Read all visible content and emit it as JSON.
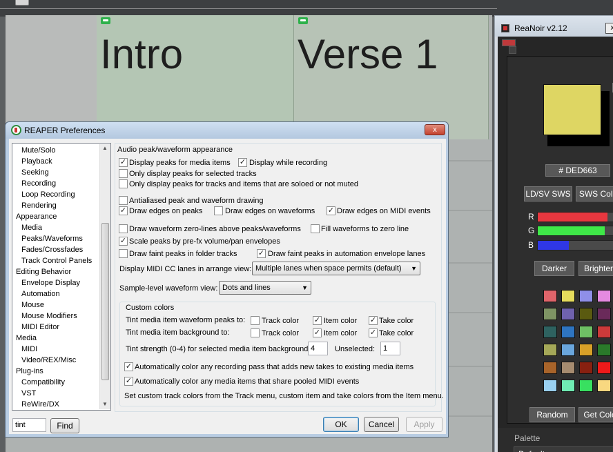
{
  "arrange": {
    "regions": [
      {
        "name": "Intro"
      },
      {
        "name": "Verse 1"
      }
    ]
  },
  "reanoir": {
    "title": "ReaNoir v2.12",
    "close_label": "x",
    "help_label": "?",
    "current_color": "#DED663",
    "hex_label": "# DED663",
    "buttons": {
      "ldsv": "LD/SV SWS",
      "sws_colors": "SWS Colors",
      "darker": "Darker",
      "brighter": "Brighter",
      "random": "Random",
      "get_color": "Get Color"
    },
    "sliders": [
      {
        "label": "R",
        "value": 222,
        "max": 255,
        "color": "#e8373f"
      },
      {
        "label": "G",
        "value": 214,
        "max": 255,
        "color": "#3fe848"
      },
      {
        "label": "B",
        "value": 99,
        "max": 255,
        "color": "#2f37e6"
      }
    ],
    "palette_grid": [
      [
        "#e0646a",
        "#e6dc5c",
        "#8f8fe8",
        "#e48ae0"
      ],
      [
        "#7e9464",
        "#6f62ae",
        "#5a5a10",
        "#6a2a5a"
      ],
      [
        "#2e6260",
        "#2e74c0",
        "#6ec064",
        "#cc3a3a"
      ],
      [
        "#a5a858",
        "#6aa6dc",
        "#d8a028",
        "#2a7a2a"
      ],
      [
        "#a8642a",
        "#a68c70",
        "#882010",
        "#ee1a1a"
      ],
      [
        "#9ad0f0",
        "#70ecb4",
        "#38e060",
        "#f8d880"
      ]
    ],
    "palette_section": {
      "label": "Palette",
      "selected": "Default"
    }
  },
  "prefs": {
    "title": "REAPER Preferences",
    "close_label": "x",
    "tree": [
      {
        "label": "Mute/Solo",
        "indent": 1
      },
      {
        "label": "Playback",
        "indent": 1
      },
      {
        "label": "Seeking",
        "indent": 1
      },
      {
        "label": "Recording",
        "indent": 1
      },
      {
        "label": "Loop Recording",
        "indent": 1
      },
      {
        "label": "Rendering",
        "indent": 1
      },
      {
        "label": "Appearance",
        "indent": 0
      },
      {
        "label": "Media",
        "indent": 1
      },
      {
        "label": "Peaks/Waveforms",
        "indent": 1
      },
      {
        "label": "Fades/Crossfades",
        "indent": 1
      },
      {
        "label": "Track Control Panels",
        "indent": 1
      },
      {
        "label": "Editing Behavior",
        "indent": 0
      },
      {
        "label": "Envelope Display",
        "indent": 1
      },
      {
        "label": "Automation",
        "indent": 1
      },
      {
        "label": "Mouse",
        "indent": 1
      },
      {
        "label": "Mouse Modifiers",
        "indent": 1
      },
      {
        "label": "MIDI Editor",
        "indent": 1
      },
      {
        "label": "Media",
        "indent": 0
      },
      {
        "label": "MIDI",
        "indent": 1
      },
      {
        "label": "Video/REX/Misc",
        "indent": 1
      },
      {
        "label": "Plug-ins",
        "indent": 0
      },
      {
        "label": "Compatibility",
        "indent": 1
      },
      {
        "label": "VST",
        "indent": 1
      },
      {
        "label": "ReWire/DX",
        "indent": 1
      }
    ],
    "search": {
      "value": "tint",
      "find_label": "Find"
    },
    "section_title": "Audio peak/waveform appearance",
    "options": {
      "display_peaks": {
        "label": "Display peaks for media items",
        "checked": true
      },
      "display_recording": {
        "label": "Display while recording",
        "checked": true
      },
      "only_selected": {
        "label": "Only display peaks for selected tracks",
        "checked": false
      },
      "only_soloed": {
        "label": "Only display peaks for tracks and items that are soloed or not muted",
        "checked": false
      },
      "antialiased": {
        "label": "Antialiased peak and waveform drawing",
        "checked": false
      },
      "edges_peaks": {
        "label": "Draw edges on peaks",
        "checked": true
      },
      "edges_waveforms": {
        "label": "Draw edges on waveforms",
        "checked": false
      },
      "edges_midi": {
        "label": "Draw edges on MIDI events",
        "checked": true
      },
      "zero_lines": {
        "label": "Draw waveform zero-lines above peaks/waveforms",
        "checked": false
      },
      "fill_zero": {
        "label": "Fill waveforms to zero line",
        "checked": false
      },
      "scale_peaks": {
        "label": "Scale peaks by pre-fx volume/pan envelopes",
        "checked": true
      },
      "faint_folder": {
        "label": "Draw faint peaks in folder tracks",
        "checked": false
      },
      "faint_automation": {
        "label": "Draw faint peaks in automation envelope lanes",
        "checked": true
      }
    },
    "midi_cc": {
      "label": "Display MIDI CC lanes in arrange view:",
      "value": "Multiple lanes when space permits (default)"
    },
    "sample_level": {
      "label": "Sample-level waveform view:",
      "value": "Dots and lines"
    },
    "custom_colors": {
      "title": "Custom colors",
      "peaks_label": "Tint media item waveform peaks to:",
      "background_label": "Tint media item background to:",
      "track_color": "Track color",
      "item_color": "Item color",
      "take_color": "Take color",
      "peaks_checks": {
        "track": false,
        "item": true,
        "take": true
      },
      "bg_checks": {
        "track": false,
        "item": true,
        "take": true
      },
      "strength_label": "Tint strength (0-4) for selected media item background:",
      "strength_value": "4",
      "unselected_label": "Unselected:",
      "unselected_value": "1",
      "auto_recording": {
        "label": "Automatically color any recording pass that adds new takes to existing media items",
        "checked": true
      },
      "auto_pooled": {
        "label": "Automatically color any media items that share pooled MIDI events",
        "checked": true
      },
      "note": "Set custom track colors from the Track menu, custom item and take colors from the Item menu."
    },
    "buttons": {
      "ok": "OK",
      "cancel": "Cancel",
      "apply": "Apply"
    }
  }
}
